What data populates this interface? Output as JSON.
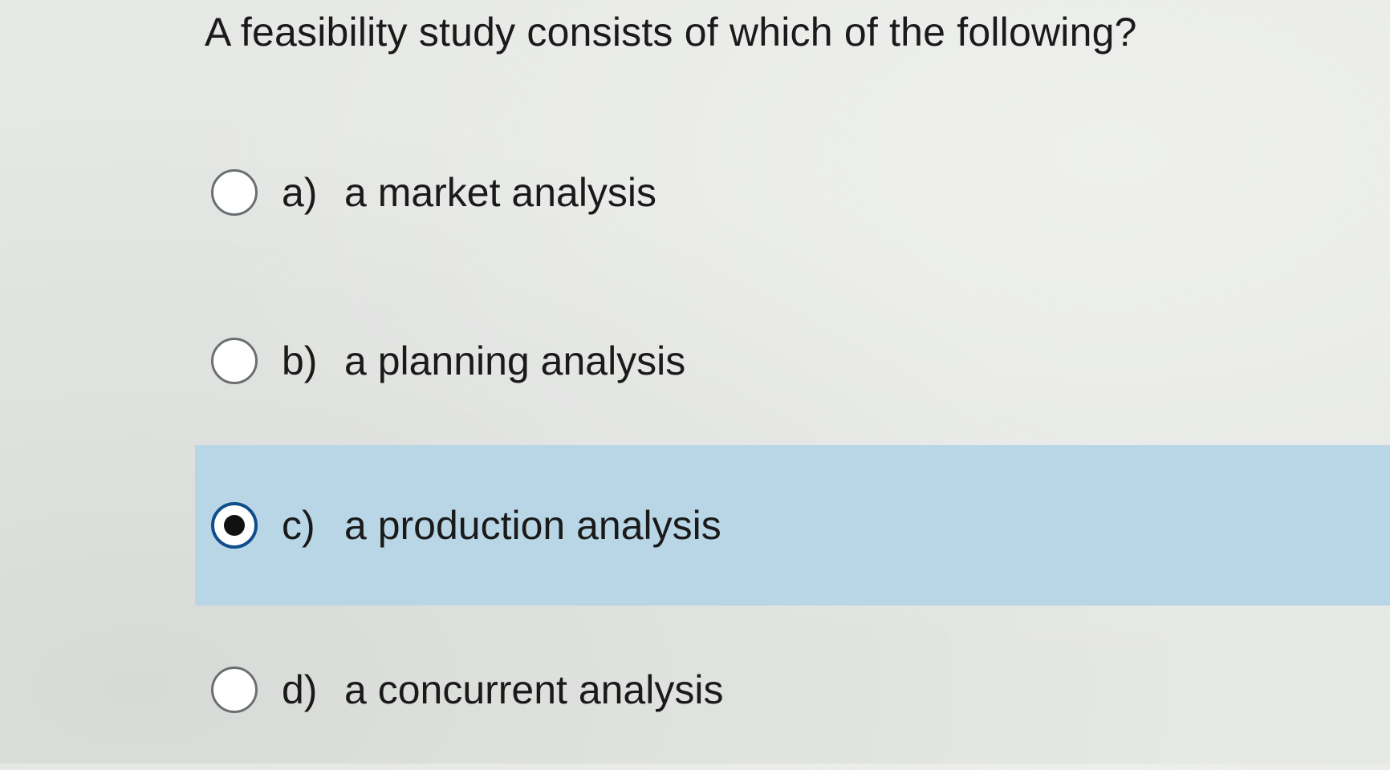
{
  "question": "A feasibility study consists of which of the following?",
  "options": [
    {
      "letter": "a)",
      "text": "a market analysis",
      "selected": false
    },
    {
      "letter": "b)",
      "text": "a planning analysis",
      "selected": false
    },
    {
      "letter": "c)",
      "text": "a production analysis",
      "selected": true
    },
    {
      "letter": "d)",
      "text": "a concurrent analysis",
      "selected": false
    }
  ],
  "colors": {
    "selected_row_background": "#b9d6e6",
    "selected_radio_border": "#0f4e8a",
    "radio_border": "#6b6f73"
  }
}
